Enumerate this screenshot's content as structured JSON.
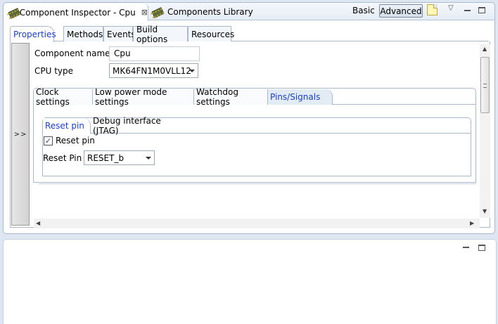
{
  "view_tabs": {
    "inspector_label": "Component Inspector - Cpu",
    "library_label": "Components Library",
    "close_glyph": "⊠"
  },
  "toolbar": {
    "basic_label": "Basic",
    "advanced_label": "Advanced"
  },
  "property_tabs": [
    "Properties",
    "Methods",
    "Events",
    "Build options",
    "Resources"
  ],
  "expander_label": ">>",
  "fields": {
    "component_name_label": "Component name",
    "component_name_value": "Cpu",
    "cpu_type_label": "CPU type",
    "cpu_type_value": "MK64FN1M0VLL12"
  },
  "settings_tabs": [
    "Clock settings",
    "Low power mode settings",
    "Watchdog settings",
    "Pins/Signals"
  ],
  "pin_tabs": [
    "Reset pin",
    "Debug interface (JTAG)"
  ],
  "reset": {
    "checkbox_label": "Reset pin",
    "checked": true,
    "pin_label": "Reset Pin",
    "pin_value": "RESET_b"
  }
}
